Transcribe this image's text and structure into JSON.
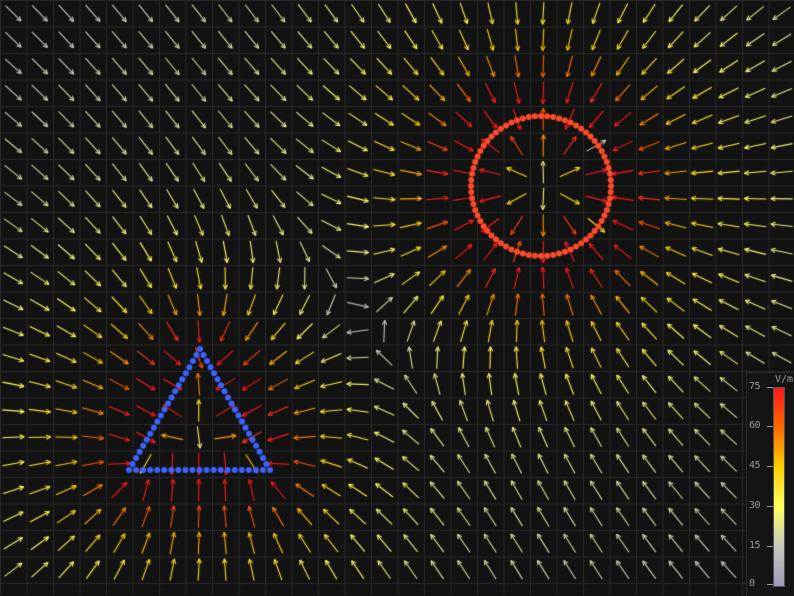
{
  "scene": {
    "background": "#121212",
    "grid_color": "#2b2b2b",
    "field_source_circle": {
      "label": "",
      "color": "#ff4a2a",
      "charge": "negative"
    },
    "field_source_triangle": {
      "label": "",
      "color": "#3d63ff",
      "charge": "negative"
    }
  },
  "colorbar": {
    "unit": "V/m",
    "ticks": [
      "75",
      "60",
      "45",
      "30",
      "15",
      "0"
    ],
    "max": 75,
    "min": 0,
    "colors": [
      "#ff1a1a",
      "#ff6a00",
      "#ffd000",
      "#ffff60",
      "#c8c8c0",
      "#9a9ab8"
    ]
  }
}
